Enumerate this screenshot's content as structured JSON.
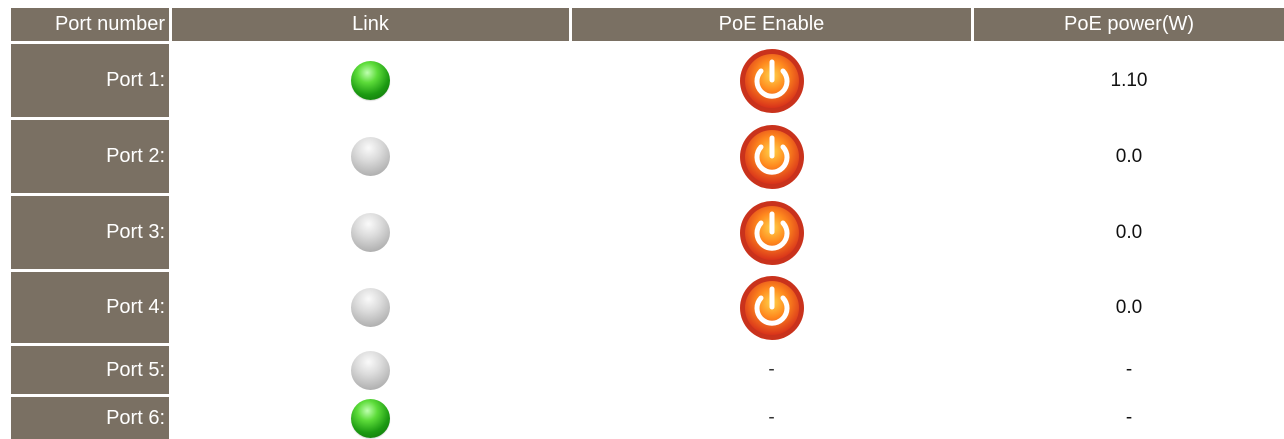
{
  "table": {
    "headers": {
      "port": "Port number",
      "link": "Link",
      "poe_enable": "PoE Enable",
      "poe_power": "PoE power(W)"
    },
    "rows": [
      {
        "label": "Port 1:",
        "link": "up",
        "poe_enabled": true,
        "power": "1.10"
      },
      {
        "label": "Port 2:",
        "link": "down",
        "poe_enabled": true,
        "power": "0.0"
      },
      {
        "label": "Port 3:",
        "link": "down",
        "poe_enabled": true,
        "power": "0.0"
      },
      {
        "label": "Port 4:",
        "link": "down",
        "poe_enabled": true,
        "power": "0.0"
      },
      {
        "label": "Port 5:",
        "link": "down",
        "poe_enabled": false,
        "poe_text": "-",
        "power": "-"
      },
      {
        "label": "Port 6:",
        "link": "up",
        "poe_enabled": false,
        "poe_text": "-",
        "power": "-"
      }
    ]
  },
  "colors": {
    "header_bg": "#7a7063",
    "link_up": "#1c9a12",
    "link_down": "#b4b4b4",
    "power_button": "#e8451c"
  },
  "icons": {
    "link_up": "green-led-icon",
    "link_down": "gray-led-icon",
    "poe_enable": "power-button-icon"
  }
}
